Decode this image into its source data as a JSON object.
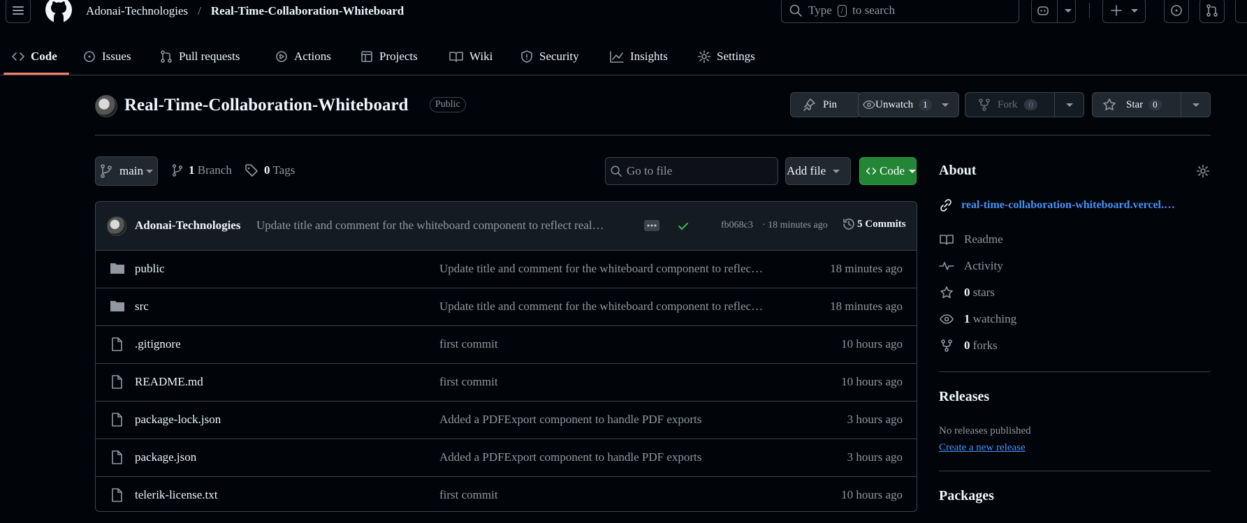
{
  "header": {
    "owner": "Adonai-Technologies",
    "separator": "/",
    "repo": "Real-Time-Collaboration-Whiteboard",
    "search_prefix": "Type",
    "search_key": "/",
    "search_suffix": "to search"
  },
  "nav": {
    "tabs": [
      {
        "label": "Code",
        "icon": "code-icon"
      },
      {
        "label": "Issues",
        "icon": "issue-icon"
      },
      {
        "label": "Pull requests",
        "icon": "pull-request-icon"
      },
      {
        "label": "Actions",
        "icon": "play-icon"
      },
      {
        "label": "Projects",
        "icon": "table-icon"
      },
      {
        "label": "Wiki",
        "icon": "book-icon"
      },
      {
        "label": "Security",
        "icon": "shield-icon"
      },
      {
        "label": "Insights",
        "icon": "graph-icon"
      },
      {
        "label": "Settings",
        "icon": "gear-icon"
      }
    ]
  },
  "repo_header": {
    "title": "Real-Time-Collaboration-Whiteboard",
    "visibility": "Public",
    "pin_label": "Pin",
    "watch_label": "Unwatch",
    "watch_count": "1",
    "fork_label": "Fork",
    "fork_count": "0",
    "star_label": "Star",
    "star_count": "0"
  },
  "toolbar": {
    "branch": "main",
    "branches_count": "1",
    "branches_label": "Branch",
    "tags_count": "0",
    "tags_label": "Tags",
    "goto_placeholder": "Go to file",
    "add_file_label": "Add file",
    "code_label": "Code"
  },
  "latest_commit": {
    "author": "Adonai-Technologies",
    "message": "Update title and comment for the whiteboard component to reflect real…",
    "sha": "fb068c3",
    "time": "· 18 minutes ago",
    "commits_label": "5 Commits"
  },
  "files": [
    {
      "name": "public",
      "type": "folder",
      "message": "Update title and comment for the whiteboard component to reflec…",
      "time": "18 minutes ago"
    },
    {
      "name": "src",
      "type": "folder",
      "message": "Update title and comment for the whiteboard component to reflec…",
      "time": "18 minutes ago"
    },
    {
      "name": ".gitignore",
      "type": "file",
      "message": "first commit",
      "time": "10 hours ago"
    },
    {
      "name": "README.md",
      "type": "file",
      "message": "first commit",
      "time": "10 hours ago"
    },
    {
      "name": "package-lock.json",
      "type": "file",
      "message": "Added a PDFExport component to handle PDF exports",
      "time": "3 hours ago"
    },
    {
      "name": "package.json",
      "type": "file",
      "message": "Added a PDFExport component to handle PDF exports",
      "time": "3 hours ago"
    },
    {
      "name": "telerik-license.txt",
      "type": "file",
      "message": "first commit",
      "time": "10 hours ago"
    }
  ],
  "about": {
    "title": "About",
    "link": "real-time-collaboration-whiteboard.vercel.…",
    "readme": "Readme",
    "activity": "Activity",
    "stars_count": "0",
    "stars_label": "stars",
    "watching_count": "1",
    "watching_label": "watching",
    "forks_count": "0",
    "forks_label": "forks"
  },
  "releases": {
    "title": "Releases",
    "empty": "No releases published",
    "create_link": "Create a new release"
  },
  "packages": {
    "title": "Packages"
  },
  "colors": {
    "background": "#010409",
    "accent_link": "#4493f8",
    "code_button": "#238636",
    "tab_underline": "#f78166",
    "check": "#3fb950"
  }
}
